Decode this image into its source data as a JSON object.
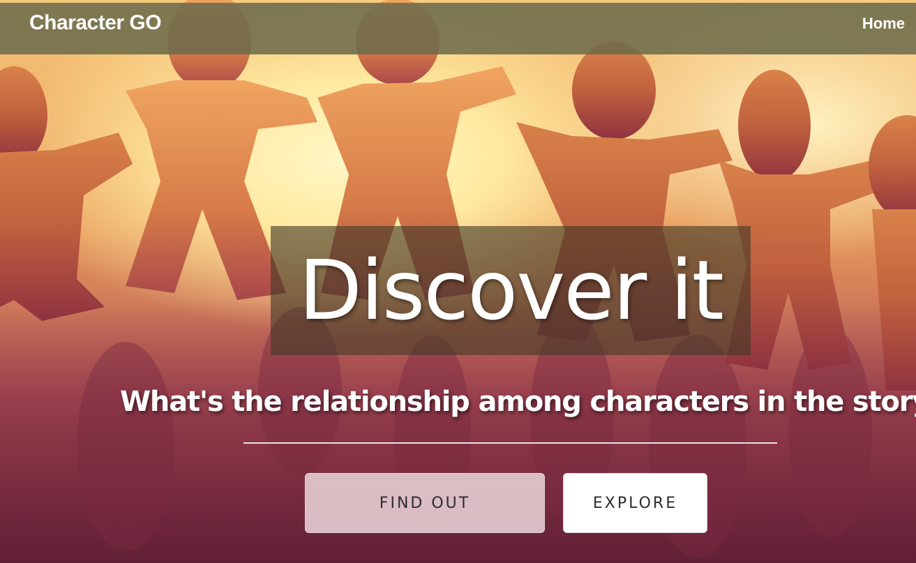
{
  "navbar": {
    "brand": "Character GO",
    "home_link": "Home"
  },
  "hero": {
    "headline": "Discover it",
    "subheadline": "What's the relationship among characters in the story?",
    "buttons": {
      "find_out": "FIND OUT",
      "explore": "EXPLORE"
    },
    "background": "paper-chain-people-photo"
  },
  "colors": {
    "navbar_bg": "#6a6a4a",
    "headline_box_bg": "#423a26",
    "find_out_button_bg": "#e8d2d6",
    "explore_button_bg": "#ffffff",
    "text_light": "#ffffff",
    "button_text": "#2c2c2c"
  }
}
